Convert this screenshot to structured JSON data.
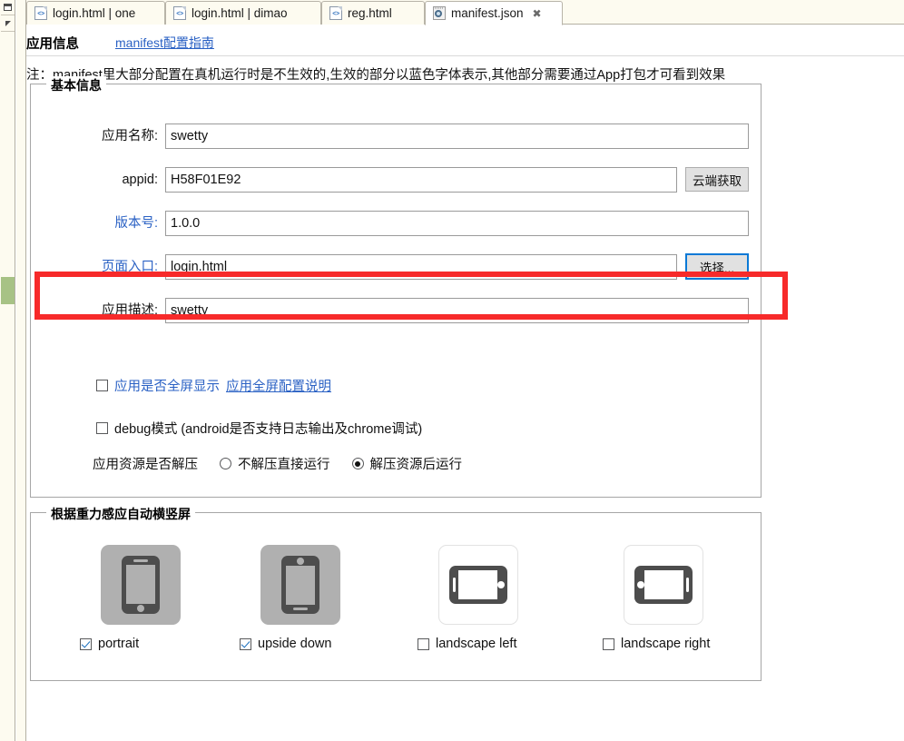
{
  "tabs": [
    {
      "label": "login.html | one",
      "icon": "html-file-icon",
      "active": false,
      "closable": false
    },
    {
      "label": "login.html | dimao",
      "icon": "html-file-icon",
      "active": false,
      "closable": false
    },
    {
      "label": "reg.html",
      "icon": "html-file-icon",
      "active": false,
      "closable": false
    },
    {
      "label": "manifest.json",
      "icon": "json-file-icon",
      "active": true,
      "closable": true,
      "close_glyph": "✖"
    }
  ],
  "header": {
    "title": "应用信息",
    "guide_link": "manifest配置指南"
  },
  "note": "注：manifest里大部分配置在真机运行时是不生效的,生效的部分以蓝色字体表示,其他部分需要通过App打包才可看到效果",
  "basic": {
    "legend": "基本信息",
    "fields": [
      {
        "label": "应用名称:",
        "value": "swetty",
        "blue": false,
        "button": null
      },
      {
        "label": "appid:",
        "value": "H58F01E92",
        "blue": false,
        "button": "云端获取"
      },
      {
        "label": "版本号:",
        "value": "1.0.0",
        "blue": true,
        "button": null
      },
      {
        "label": "页面入口:",
        "value": "login.html",
        "blue": true,
        "button": "选择..."
      },
      {
        "label": "应用描述:",
        "value": "swetty",
        "blue": false,
        "button": null
      }
    ],
    "fullscreen": {
      "label": "应用是否全屏显示",
      "link": "应用全屏配置说明",
      "checked": false
    },
    "debug": {
      "label": "debug模式 (android是否支持日志输出及chrome调试)",
      "checked": false
    },
    "unpack": {
      "label": "应用资源是否解压",
      "options": [
        {
          "label": "不解压直接运行",
          "selected": false
        },
        {
          "label": "解压资源后运行",
          "selected": true
        }
      ]
    }
  },
  "orientation": {
    "legend": "根据重力感应自动横竖屏",
    "items": [
      {
        "label": "portrait",
        "icon": "phone-portrait-icon",
        "checked": true
      },
      {
        "label": "upside down",
        "icon": "phone-upside-down-icon",
        "checked": true
      },
      {
        "label": "landscape left",
        "icon": "phone-landscape-left-icon",
        "checked": false
      },
      {
        "label": "landscape right",
        "icon": "phone-landscape-right-icon",
        "checked": false
      }
    ]
  },
  "highlight": {
    "color": "#f72a2a",
    "target": "页面入口:"
  },
  "colors": {
    "link_blue": "#2a61c4",
    "focus_blue": "#0a79d6",
    "highlight_red": "#f72a2a",
    "tab_inactive_bg": "#fdfbf0",
    "marker_green": "#a7c285"
  }
}
